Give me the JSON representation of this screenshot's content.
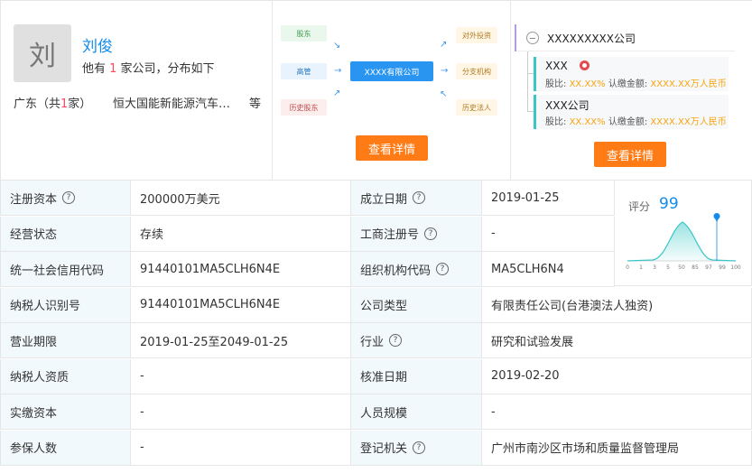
{
  "person": {
    "avatar_char": "刘",
    "name": "刘俊",
    "sub_prefix": "他有 ",
    "sub_count": "1",
    "sub_suffix": " 家公司，分布如下",
    "region_prefix": "广东（共",
    "region_count": "1",
    "region_suffix": "家）",
    "company": "恒大国能新能源汽车（广州）有限公司",
    "more": "等"
  },
  "structure_diagram": {
    "left_nodes": [
      "股东",
      "高管",
      "历史股东"
    ],
    "center_node": "XXXX有限公司",
    "right_nodes": [
      "对外投资",
      "分支机构",
      "历史法人"
    ],
    "button": "查看详情"
  },
  "equity_tree": {
    "root": "XXXXXXXXX公司",
    "children": [
      {
        "name": "XXX",
        "ratio_label": "股比:",
        "ratio": "XX.XX%",
        "amount_label": "认缴金额:",
        "amount": "XXXX.XX万人民币"
      },
      {
        "name": "XXX公司",
        "ratio_label": "股比:",
        "ratio": "XX.XX%",
        "amount_label": "认缴金额:",
        "amount": "XXXX.XX万人民币"
      }
    ],
    "button": "查看详情"
  },
  "info": {
    "rows": [
      {
        "l1": "注册资本",
        "v1": "200000万美元",
        "l2": "成立日期",
        "v2": "2019-01-25"
      },
      {
        "l1": "经营状态",
        "v1": "存续",
        "l2": "工商注册号",
        "v2": "-"
      },
      {
        "l1": "统一社会信用代码",
        "v1": "91440101MA5CLH6N4E",
        "l2": "组织机构代码",
        "v2": "MA5CLH6N4"
      },
      {
        "l1": "纳税人识别号",
        "v1": "91440101MA5CLH6N4E",
        "l2": "公司类型",
        "v2": "有限责任公司(台港澳法人独资)"
      },
      {
        "l1": "营业期限",
        "v1": "2019-01-25至2049-01-25",
        "l2": "行业",
        "v2": "研究和试验发展"
      },
      {
        "l1": "纳税人资质",
        "v1": "-",
        "l2": "核准日期",
        "v2": "2019-02-20"
      },
      {
        "l1": "实缴资本",
        "v1": "-",
        "l2": "人员规模",
        "v2": "-"
      },
      {
        "l1": "参保人数",
        "v1": "-",
        "l2": "登记机关",
        "v2": "广州市南沙区市场和质量监督管理局"
      }
    ]
  },
  "score": {
    "label": "评分",
    "value": "99",
    "ticks": [
      "0",
      "1",
      "3",
      "5",
      "50",
      "85",
      "97",
      "99",
      "100"
    ],
    "line_color": "#39c6c6",
    "marker_color": "#128bed"
  }
}
